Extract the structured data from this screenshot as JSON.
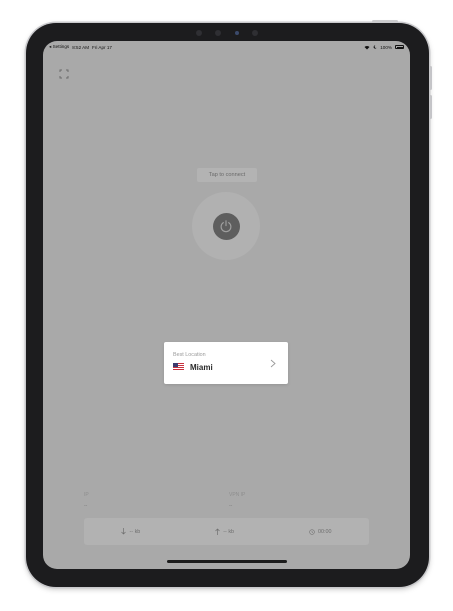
{
  "status_bar": {
    "back_label": "◂ Settings",
    "time": "8:52 AM",
    "date": "Fri Apr 17",
    "battery": "100%"
  },
  "main": {
    "tap_label": "Tap to connect"
  },
  "location": {
    "title": "Best Location",
    "name": "Miami",
    "flag": "us-flag-icon"
  },
  "info": {
    "ip_label": "IP",
    "ip_value": "--",
    "vpn_ip_label": "VPN IP",
    "vpn_ip_value": "--"
  },
  "stats": {
    "download": "-- kb",
    "upload": "-- kb",
    "time": "00:00"
  },
  "colors": {
    "screen_overlay": "#a9a9a9",
    "card": "#ffffff",
    "power_button": "#5e5e5e"
  }
}
